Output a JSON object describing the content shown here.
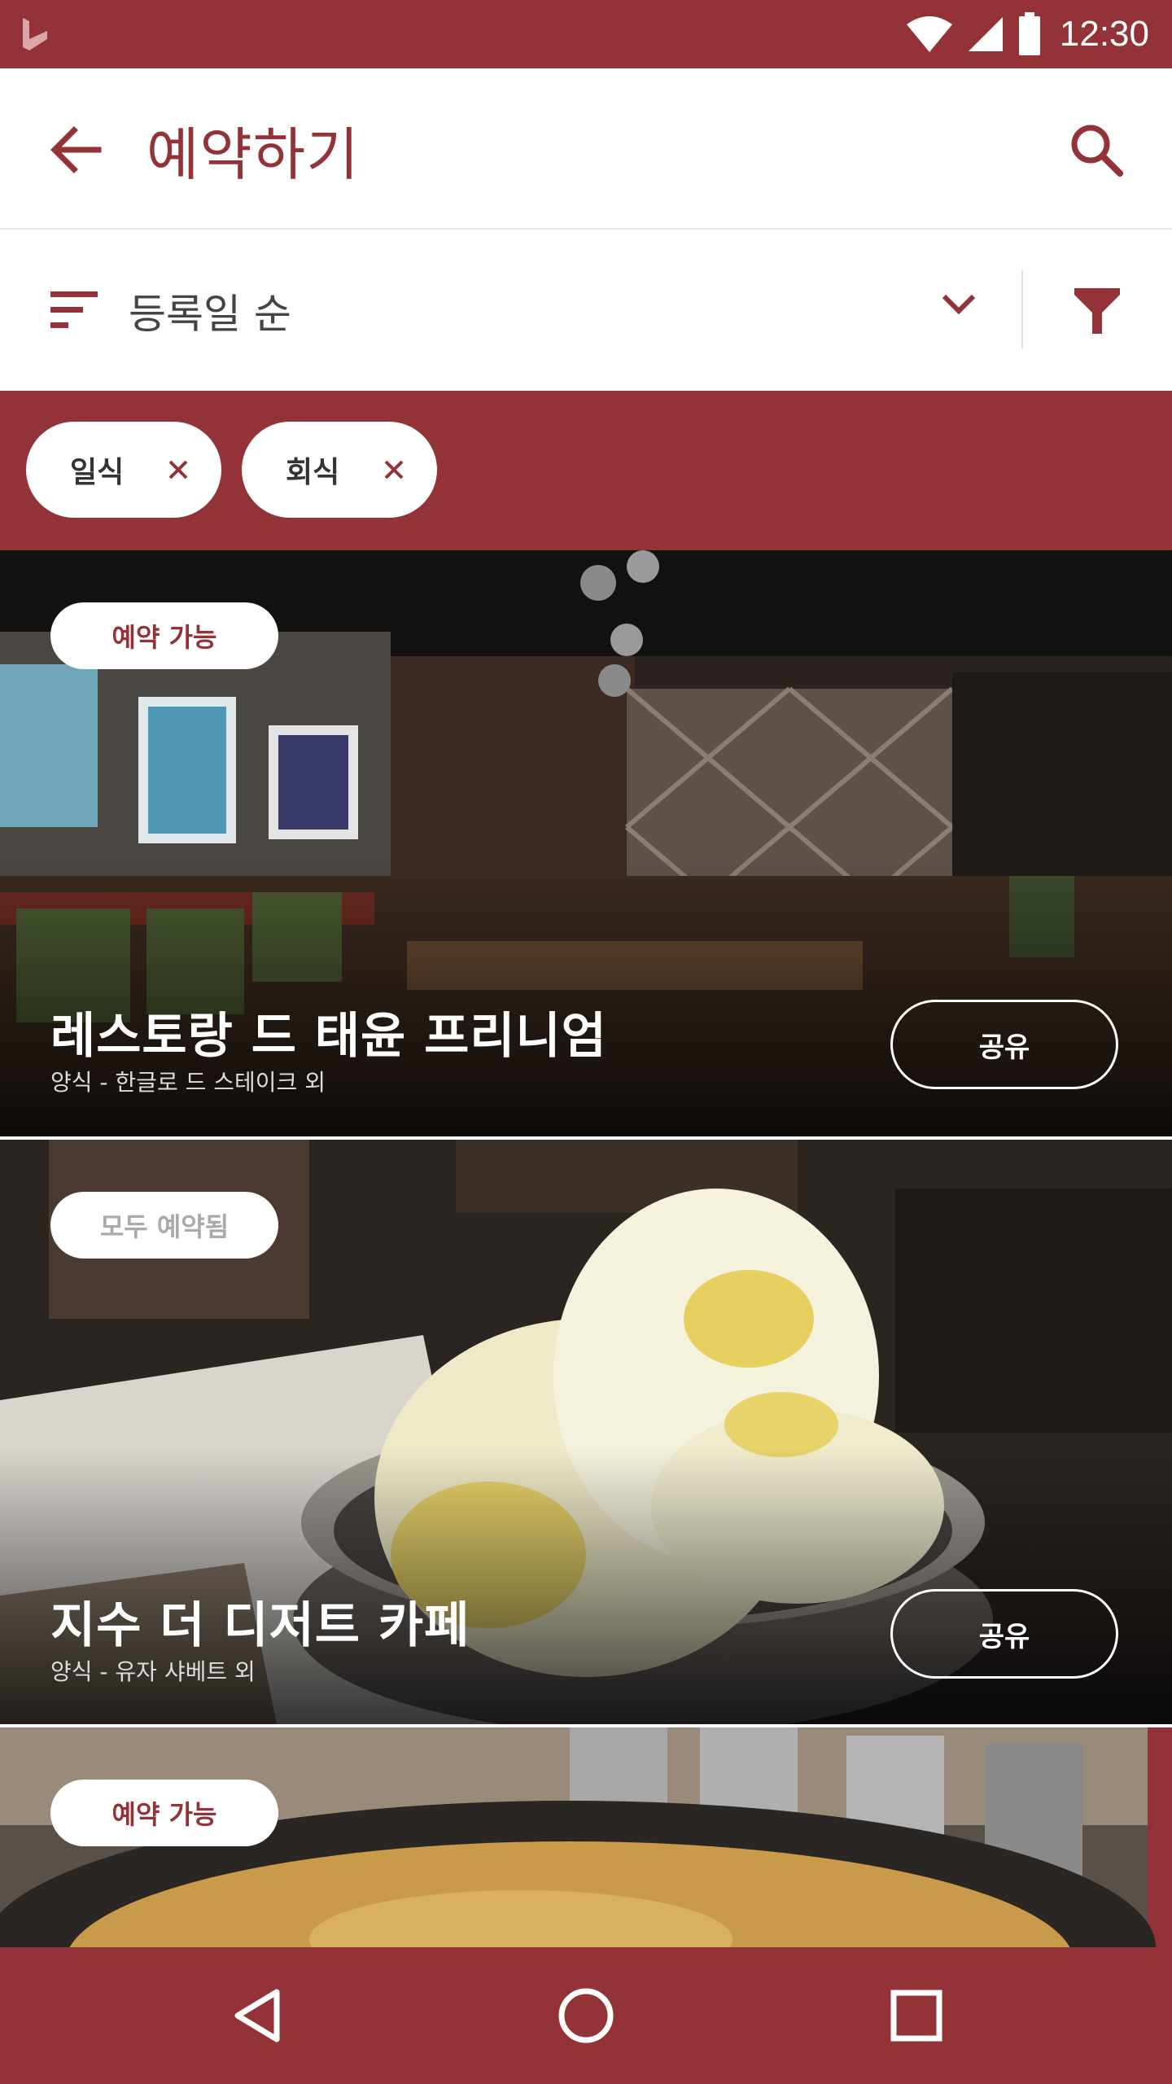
{
  "colors": {
    "brand": "#933237",
    "available": "#933237",
    "booked": "#aaaaaa"
  },
  "status_bar": {
    "time": "12:30"
  },
  "app_bar": {
    "title": "예약하기"
  },
  "sort_bar": {
    "label": "등록일 순"
  },
  "filters": [
    {
      "label": "일식"
    },
    {
      "label": "회식"
    }
  ],
  "cards": [
    {
      "badge": "예약 가능",
      "title": "레스토랑 드 태윤 프리니엄",
      "subtitle": "양식 - 한글로 드 스테이크 외",
      "share": "공유"
    },
    {
      "badge": "모두 예약됨",
      "title": "지수 더 디저트 카페",
      "subtitle": "양식 - 유자 샤베트 외",
      "share": "공유"
    },
    {
      "badge": "예약 가능"
    }
  ]
}
